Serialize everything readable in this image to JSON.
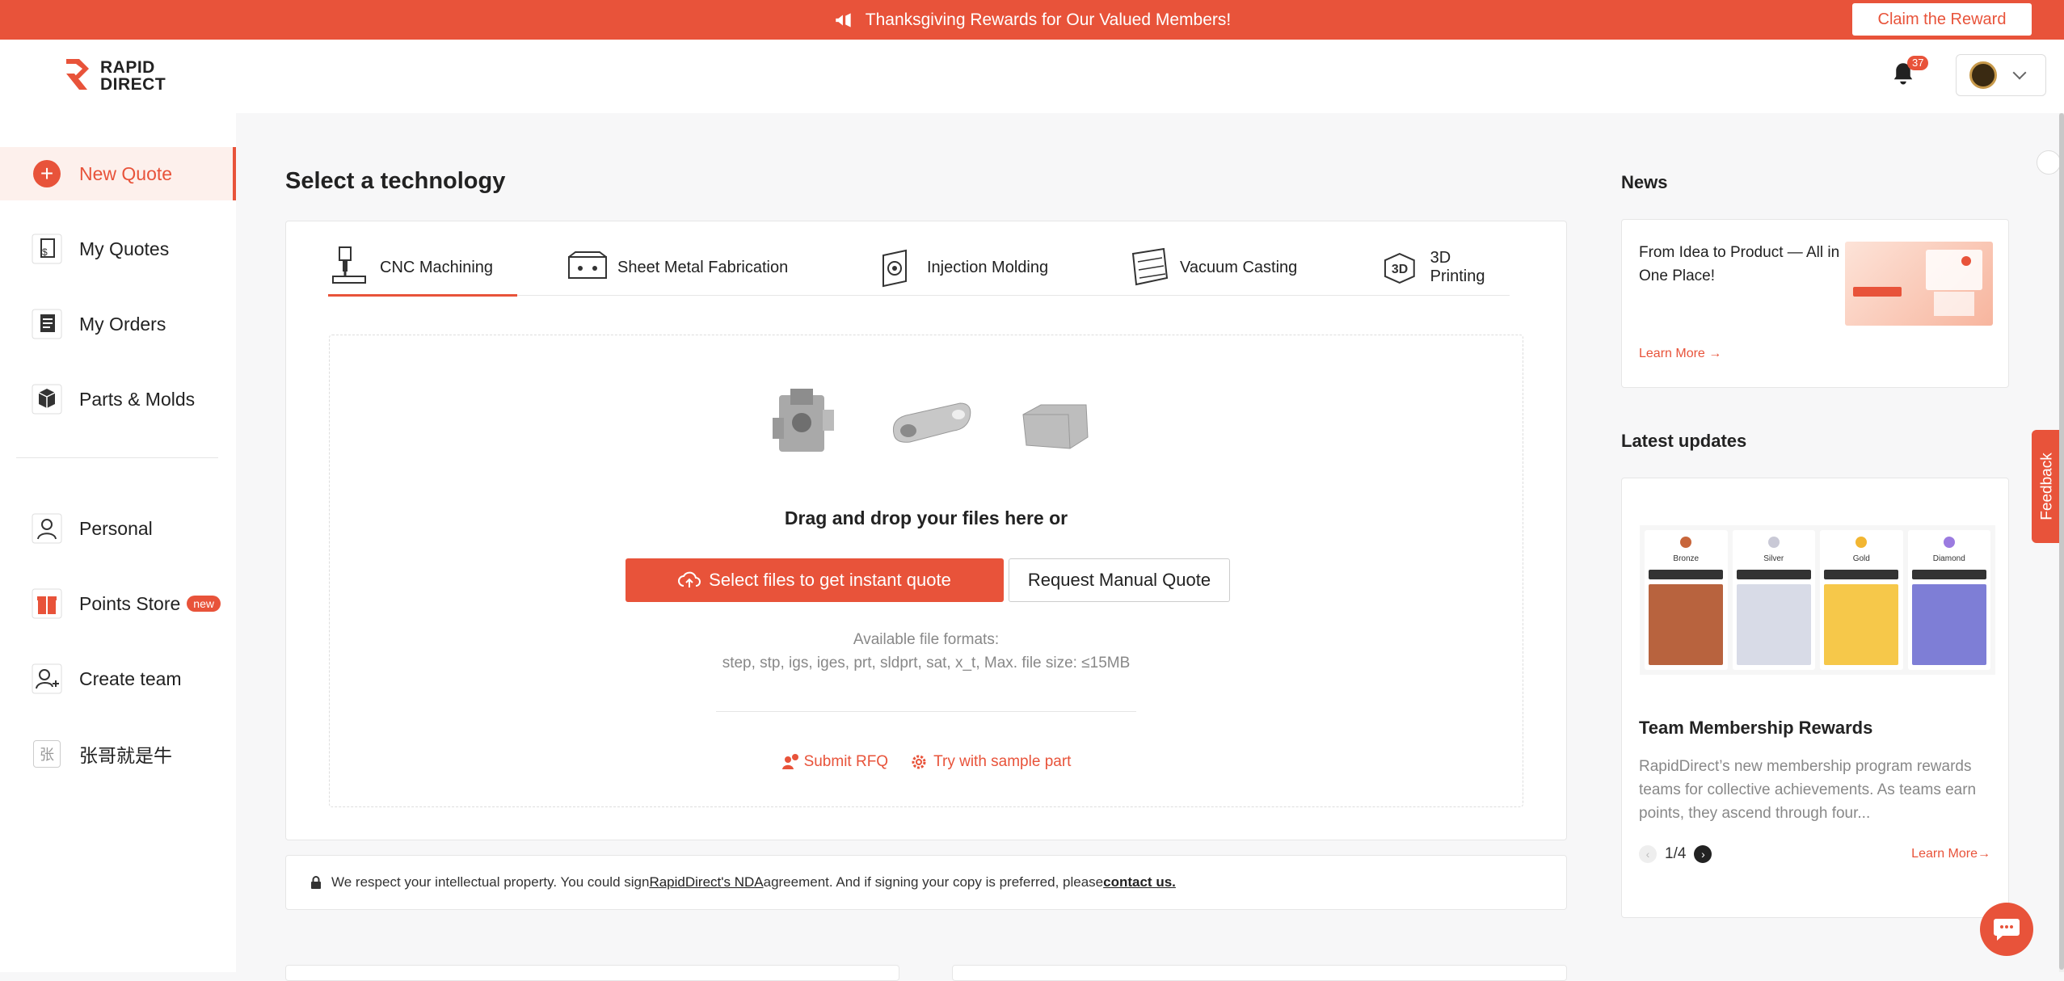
{
  "banner": {
    "text": "Thanksgiving Rewards for Our Valued Members!",
    "button": "Claim the Reward"
  },
  "header": {
    "logo_line1": "RAPID",
    "logo_line2": "DIRECT",
    "notification_count": "37"
  },
  "sidebar": {
    "items": [
      {
        "label": "New Quote"
      },
      {
        "label": "My Quotes"
      },
      {
        "label": "My Orders"
      },
      {
        "label": "Parts & Molds"
      },
      {
        "label": "Personal"
      },
      {
        "label": "Points Store",
        "badge": "new"
      },
      {
        "label": "Create team"
      },
      {
        "label": "张哥就是牛",
        "avatar_char": "张"
      }
    ]
  },
  "main": {
    "title": "Select a technology",
    "tabs": [
      {
        "label": "CNC Machining"
      },
      {
        "label": "Sheet Metal Fabrication"
      },
      {
        "label": "Injection Molding"
      },
      {
        "label": "Vacuum Casting"
      },
      {
        "label": "3D Printing"
      }
    ],
    "dropzone": {
      "heading": "Drag and drop your files here or",
      "select_button": "Select files to get instant quote",
      "manual_button": "Request Manual Quote",
      "formats_line1": "Available file formats:",
      "formats_line2": "step, stp, igs, iges, prt, sldprt, sat, x_t, Max. file size: ≤15MB",
      "submit_rfq": "Submit RFQ",
      "try_sample": "Try with sample part"
    },
    "nda": {
      "text1": "We respect your intellectual property. You could sign ",
      "link1": "RapidDirect's NDA",
      "text2": " agreement. And if signing your copy is preferred, please ",
      "link2": "contact us."
    }
  },
  "right": {
    "news_title": "News",
    "news_text": "From Idea to Product — All in One Place!",
    "news_learn": "Learn More →",
    "updates_title": "Latest updates",
    "tiers": [
      "Bronze",
      "Silver",
      "Gold",
      "Diamond"
    ],
    "update_heading": "Team Membership Rewards",
    "update_desc": "RapidDirect’s new membership program rewards teams for collective achievements. As teams earn points, they ascend through four...",
    "pager": "1/4",
    "update_learn": "Learn More→"
  },
  "feedback_label": "Feedback",
  "colors": {
    "accent": "#e8533a"
  }
}
